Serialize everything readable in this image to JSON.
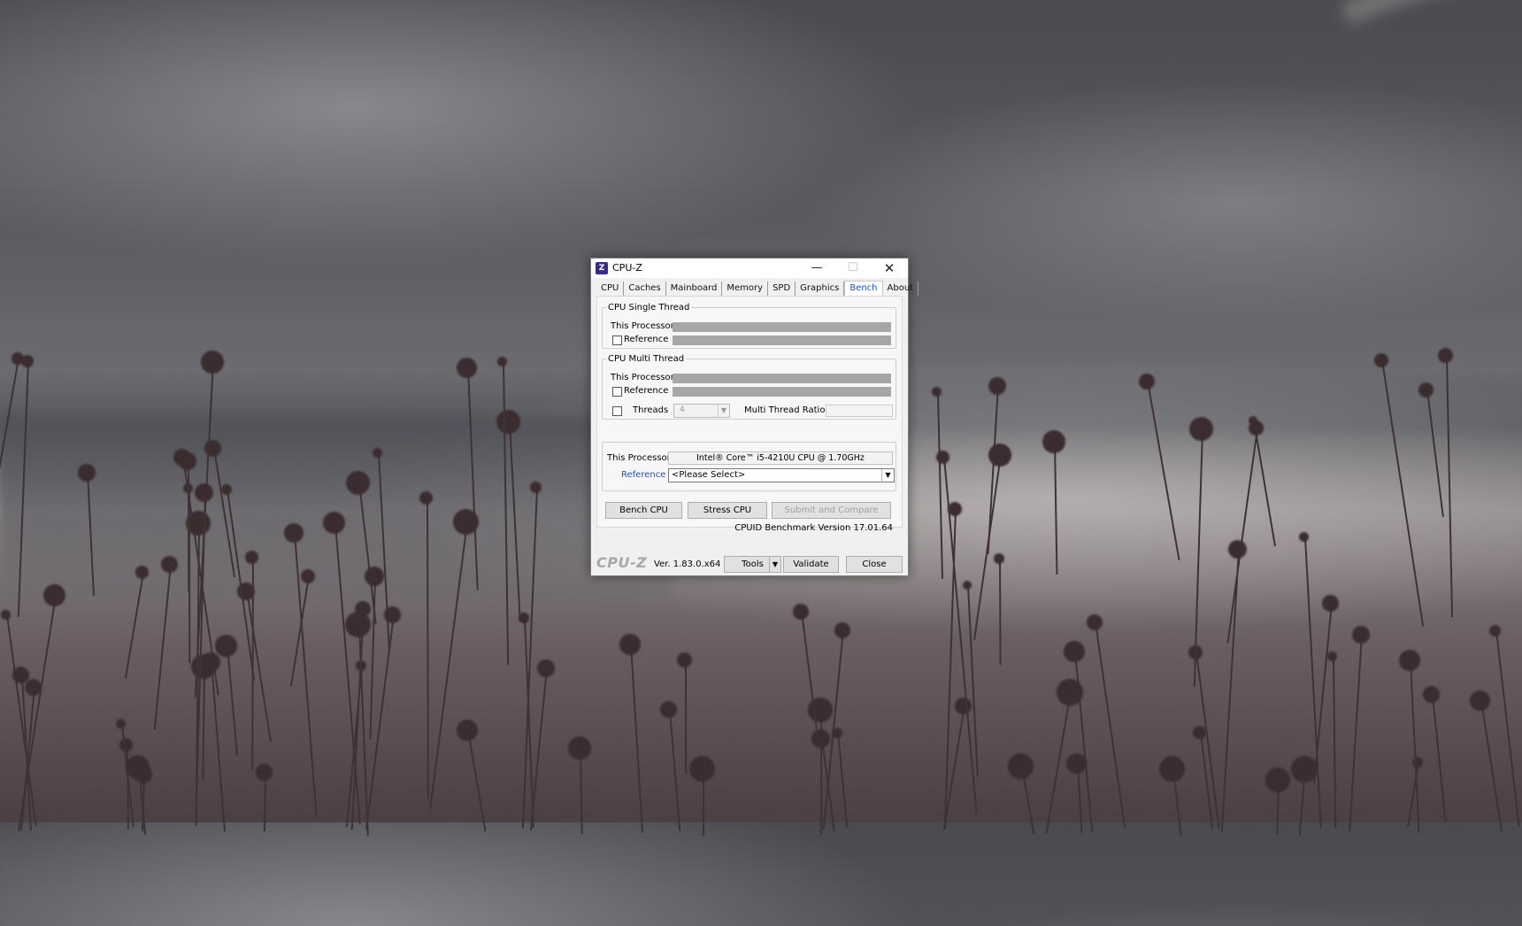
{
  "window": {
    "title": "CPU-Z",
    "icon_label": "Z",
    "controls": {
      "minimize": "—",
      "maximize": "☐",
      "close": "✕"
    }
  },
  "tabs": [
    {
      "label": "CPU"
    },
    {
      "label": "Caches"
    },
    {
      "label": "Mainboard"
    },
    {
      "label": "Memory"
    },
    {
      "label": "SPD"
    },
    {
      "label": "Graphics"
    },
    {
      "label": "Bench",
      "active": true
    },
    {
      "label": "About"
    }
  ],
  "single_thread": {
    "title": "CPU Single Thread",
    "this_processor_label": "This Processor",
    "reference_label": "Reference"
  },
  "multi_thread": {
    "title": "CPU Multi Thread",
    "this_processor_label": "This Processor",
    "reference_label": "Reference",
    "threads_label": "Threads",
    "threads_value": "4",
    "ratio_label": "Multi Thread Ratio"
  },
  "processor": {
    "this_processor_label": "This Processor",
    "this_processor_value": "Intel® Core™ i5-4210U CPU @ 1.70GHz",
    "reference_label": "Reference",
    "reference_select_value": "<Please Select>"
  },
  "buttons": {
    "bench_cpu": "Bench CPU",
    "stress_cpu": "Stress CPU",
    "submit_compare": "Submit and Compare"
  },
  "bench_version": "CPUID Benchmark Version 17.01.64",
  "footer": {
    "logo": "CPU-Z",
    "version": "Ver. 1.83.0.x64",
    "tools": "Tools",
    "validate": "Validate",
    "close": "Close"
  },
  "colors": {
    "accent": "#1f4fd0",
    "bar": "#a6a6a6",
    "icon_bg": "#3b2a8c"
  }
}
